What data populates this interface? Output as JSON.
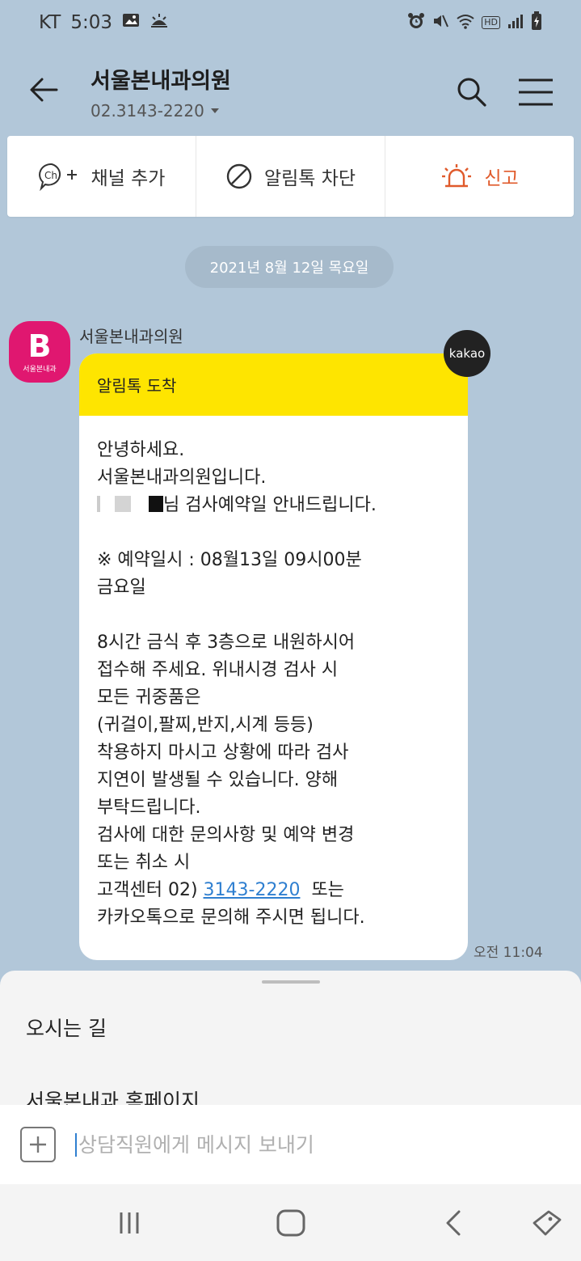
{
  "status_bar": {
    "carrier": "KT",
    "time": "5:03",
    "hd_label": "HD"
  },
  "header": {
    "title": "서울본내과의원",
    "phone": "02.3143-2220"
  },
  "actions": [
    {
      "label": "채널 추가",
      "icon": "channel-add-icon"
    },
    {
      "label": "알림톡 차단",
      "icon": "block-icon"
    },
    {
      "label": "신고",
      "icon": "siren-icon"
    }
  ],
  "date_divider": "2021년 8월 12일 목요일",
  "message": {
    "sender": "서울본내과의원",
    "avatar_letter": "B",
    "avatar_caption": "서울본내과",
    "badge": "kakao",
    "header": "알림톡 도착",
    "line1": "안녕하세요.\n서울본내과의원입니다.\n",
    "line2": "님 검사예약일 안내드립니다.\n\n※ 예약일시 : 08월13일 09시00분\n금요일\n\n8시간 금식 후 3층으로 내원하시어\n접수해 주세요. 위내시경 검사 시\n모든 귀중품은\n(귀걸이,팔찌,반지,시계 등등)\n착용하지 마시고 상황에 따라 검사\n지연이 발생될 수 있습니다. 양해\n부탁드립니다.\n검사에 대한 문의사항 및 예약 변경\n또는 취소 시\n고객센터 02) ",
    "link": "3143-2220",
    "line3": "  또는\n카카오톡으로 문의해 주시면 됩니다.",
    "time": "오전 11:04"
  },
  "sheet": {
    "items": [
      "오시는 길",
      "서울본내과 홈페이지"
    ]
  },
  "composer": {
    "placeholder": "상담직원에게 메시지 보내기"
  },
  "colors": {
    "chat_bg": "#b2c7d9",
    "bubble_header": "#fee500",
    "avatar": "#e01770",
    "report": "#e05a2b",
    "link": "#2f7fd0"
  }
}
